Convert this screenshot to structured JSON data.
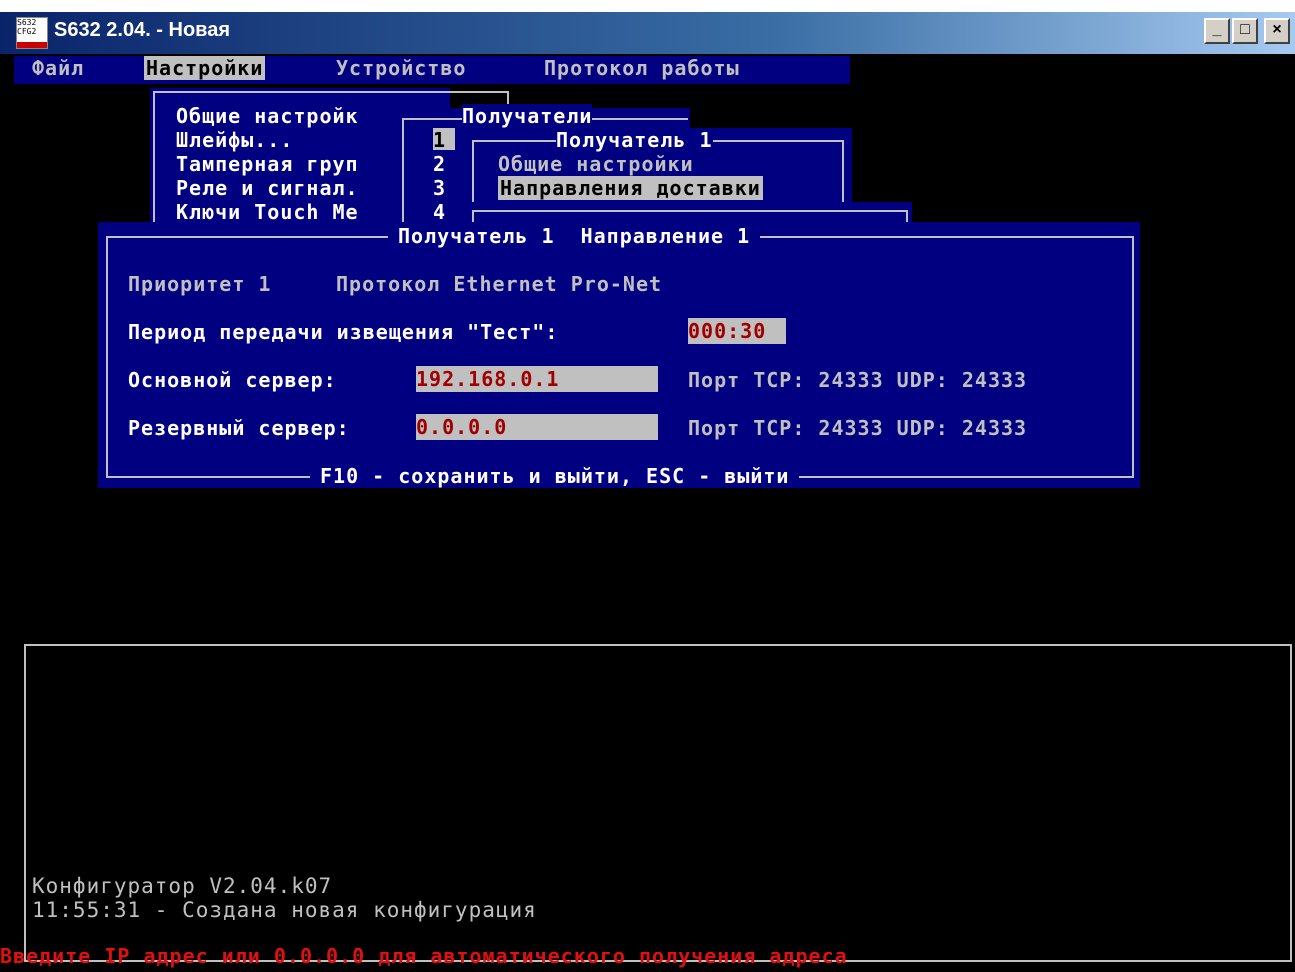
{
  "window": {
    "title": "S632 2.04. - Новая",
    "icon_text": "S632 CFG2",
    "controls": {
      "minimize": "_",
      "maximize": "□",
      "close": "×"
    }
  },
  "menubar": {
    "items": [
      {
        "label": "Файл"
      },
      {
        "label": "Настройки",
        "active": true
      },
      {
        "label": "Устройство"
      },
      {
        "label": "Протокол работы"
      }
    ]
  },
  "settings_menu": {
    "items": [
      "Общие настройк",
      "Шлейфы...",
      "Тамперная груп",
      "Реле и сигнал.",
      "Ключи Touch Me"
    ]
  },
  "recipients_menu": {
    "title": "Получатели",
    "items": [
      "1",
      "2",
      "3",
      "4"
    ],
    "selected": "1"
  },
  "recipient1_menu": {
    "title": "Получатель 1",
    "items": [
      "Общие настройки",
      "Направления доставки"
    ],
    "selected": "Направления доставки"
  },
  "dialog": {
    "title": "Получатель 1  Направление 1",
    "priority_label": "Приоритет 1",
    "protocol_label": "Протокол Ethernet Pro-Net",
    "test_period_label": "Период передачи извещения \"Тест\":",
    "test_period_value": "000:30",
    "main_server_label": "Основной сервер:",
    "main_server_value": "192.168.0.1",
    "backup_server_label": "Резервный сервер:",
    "backup_server_value": "0.0.0.0",
    "main_port": "Порт TCP: 24333 UDP: 24333",
    "backup_port": "Порт TCP: 24333 UDP: 24333",
    "footer": "F10 - сохранить и выйти, ESC - выйти"
  },
  "console": {
    "lines": [
      "Конфигуратор V2.04.k07",
      "11:55:31 - Создана новая конфигурация"
    ]
  },
  "status": "Введите IP адрес или 0.0.0.0 для автоматического получения адреса",
  "colors": {
    "terminal_bg": "#000000",
    "menu_bg": "#000080",
    "frame": "#c0c0c0",
    "status_text": "#e01010"
  }
}
